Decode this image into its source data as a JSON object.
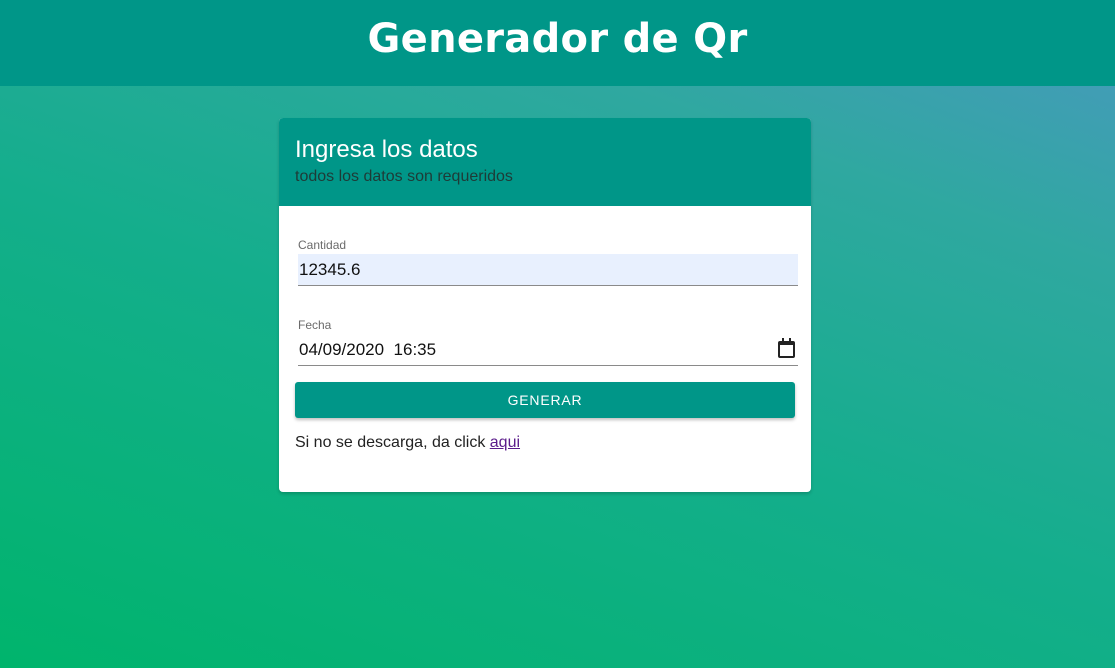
{
  "header": {
    "title": "Generador de Qr"
  },
  "card": {
    "title": "Ingresa los datos",
    "subtitle": "todos los datos son requeridos"
  },
  "form": {
    "cantidad": {
      "label": "Cantidad",
      "value": "12345.6"
    },
    "fecha": {
      "label": "Fecha",
      "value": "04/09/2020  16:35",
      "icon": "calendar-icon"
    },
    "submit_label": "GENERAR"
  },
  "footer_note": {
    "text": "Si no se descarga, da click ",
    "link_label": "aqui"
  },
  "colors": {
    "primary": "#009688",
    "autofill_bg": "#e8f0fe",
    "link_visited": "#5a1a8a",
    "background_gradient": [
      "#4a98c0",
      "#00b46c"
    ]
  }
}
